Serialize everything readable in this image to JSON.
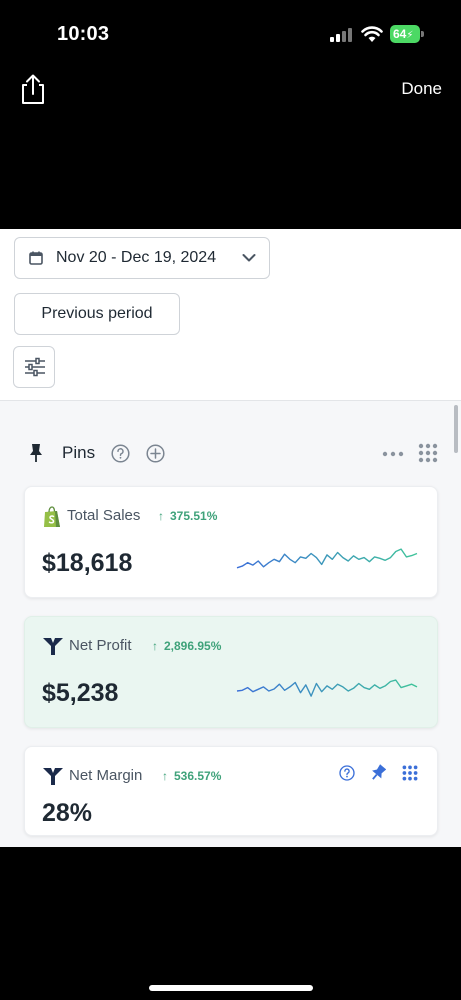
{
  "status_bar": {
    "time": "10:03",
    "battery": "64",
    "icons": [
      "signal-icon",
      "wifi-icon",
      "battery-charging-icon"
    ]
  },
  "nav": {
    "share_icon": "share-icon",
    "done_label": "Done"
  },
  "controls": {
    "date_range": "Nov 20 - Dec 19, 2024",
    "compare": "Previous period",
    "icons": [
      "calendar-icon",
      "chevron-down-icon",
      "sliders-icon"
    ]
  },
  "pins": {
    "title": "Pins",
    "icons": [
      "pin-icon",
      "help-icon",
      "add-icon",
      "more-icon",
      "grid-icon"
    ]
  },
  "colors": {
    "positive": "#3fa27a",
    "brand_navy": "#1b2a4a",
    "shopify_green": "#5e8e3e",
    "highlight_bg": "#eaf6f1",
    "action_blue": "#3b6fd8"
  },
  "cards": [
    {
      "title": "Total Sales",
      "change": "375.51%",
      "value": "$18,618",
      "icon": "shopify-bag-icon",
      "sparkline": [
        0.3,
        0.35,
        0.45,
        0.38,
        0.5,
        0.33,
        0.45,
        0.55,
        0.48,
        0.7,
        0.55,
        0.45,
        0.62,
        0.58,
        0.72,
        0.6,
        0.4,
        0.68,
        0.55,
        0.75,
        0.6,
        0.5,
        0.65,
        0.55,
        0.6,
        0.48,
        0.62,
        0.58,
        0.52,
        0.6,
        0.78,
        0.85,
        0.62,
        0.66,
        0.72
      ]
    },
    {
      "title": "Net Profit",
      "change": "2,896.95%",
      "value": "$5,238",
      "icon": "triple-whale-icon",
      "sparkline": [
        0.5,
        0.52,
        0.6,
        0.48,
        0.55,
        0.62,
        0.5,
        0.56,
        0.7,
        0.52,
        0.62,
        0.75,
        0.45,
        0.68,
        0.35,
        0.72,
        0.48,
        0.65,
        0.55,
        0.7,
        0.62,
        0.5,
        0.58,
        0.72,
        0.6,
        0.55,
        0.68,
        0.58,
        0.65,
        0.78,
        0.82,
        0.6,
        0.65,
        0.7,
        0.62
      ]
    },
    {
      "title": "Net Margin",
      "change": "536.57%",
      "value": "28%",
      "icon": "triple-whale-icon",
      "actions": [
        "help-icon",
        "pin-icon",
        "grid-icon"
      ]
    }
  ]
}
